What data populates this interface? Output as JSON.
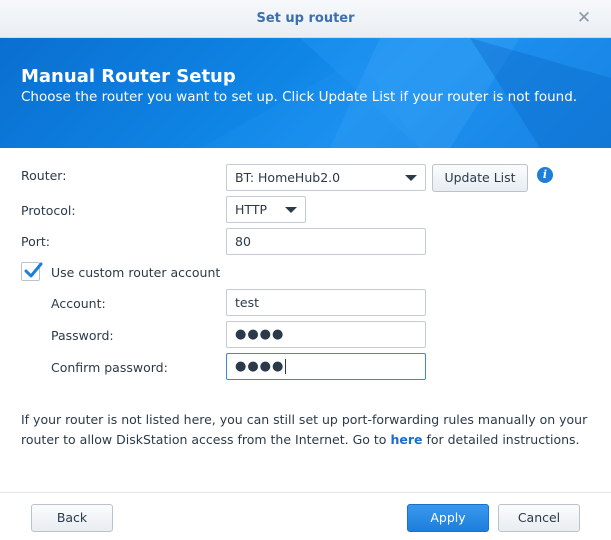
{
  "window": {
    "title": "Set up router",
    "close_symbol": "✕"
  },
  "banner": {
    "heading": "Manual Router Setup",
    "subtitle": "Choose the router you want to set up. Click Update List if your router is not found."
  },
  "form": {
    "router_label": "Router:",
    "router_value": "BT: HomeHub2.0",
    "update_list_label": "Update List",
    "info_symbol": "i",
    "protocol_label": "Protocol:",
    "protocol_value": "HTTP",
    "port_label": "Port:",
    "port_value": "80",
    "custom_account_label": "Use custom router account",
    "custom_account_checked": true,
    "account_label": "Account:",
    "account_value": "test",
    "password_label": "Password:",
    "password_value": "●●●●",
    "confirm_password_label": "Confirm password:",
    "confirm_password_value": "●●●●"
  },
  "note": {
    "text_before": "If your router is not listed here, you can still set up port-forwarding rules manually on your router to allow DiskStation access from the Internet. Go to ",
    "link": "here",
    "text_after": " for detailed instructions."
  },
  "footer": {
    "back_label": "Back",
    "apply_label": "Apply",
    "cancel_label": "Cancel"
  },
  "colors": {
    "accent": "#1c7fdc",
    "banner": "#0f86e6",
    "title": "#3b6fae",
    "link": "#1b6fc9"
  }
}
